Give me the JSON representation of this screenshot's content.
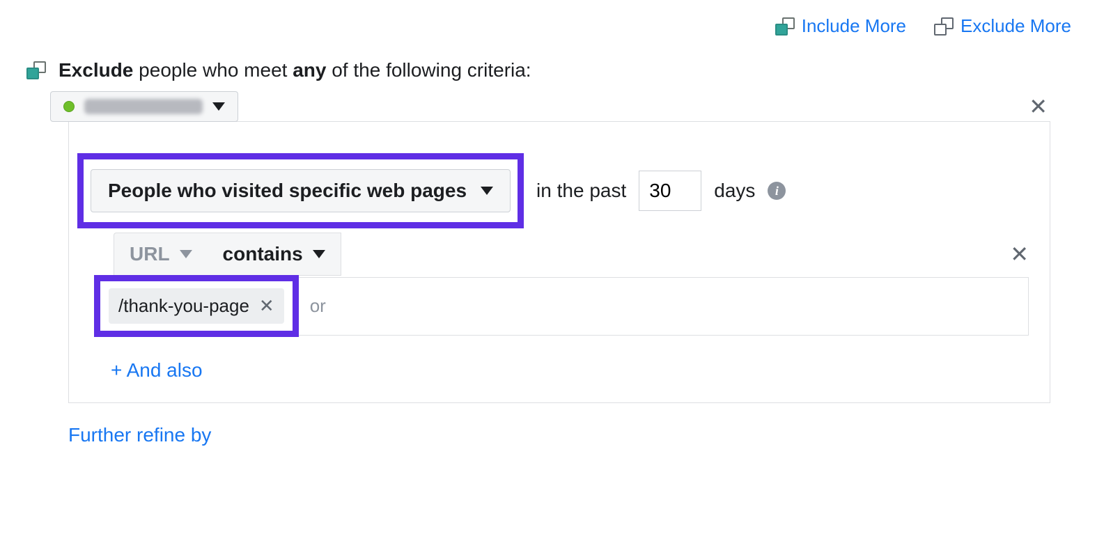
{
  "topLinks": {
    "include": "Include More",
    "exclude": "Exclude More"
  },
  "section": {
    "verb": "Exclude",
    "mid": " people who meet ",
    "quant": "any",
    "tail": " of the following criteria:"
  },
  "pixel": {
    "name": "Pixel (redacted)"
  },
  "criteria": {
    "visitTypeLabel": "People who visited specific web pages",
    "inThePast": "in the past",
    "daysValue": "30",
    "daysLabel": "days",
    "urlField": "URL",
    "matchOp": "contains",
    "urlTag": "/thank-you-page",
    "orPlaceholder": "or",
    "andAlso": "+ And also"
  },
  "furtherRefine": "Further refine by"
}
